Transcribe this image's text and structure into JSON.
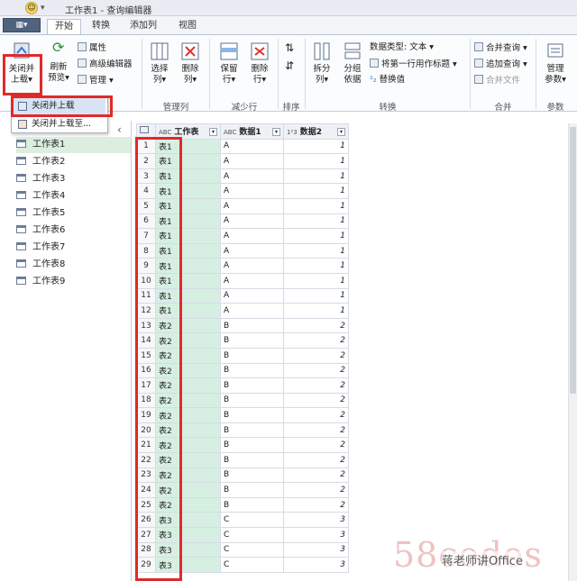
{
  "window": {
    "title": "工作表1 - 查询编辑器"
  },
  "tabs": {
    "file": "▦▾",
    "home": "开始",
    "transform": "转换",
    "add_column": "添加列",
    "view": "视图"
  },
  "ribbon": {
    "close_load": "关闭并\n上载",
    "close_load_line1": "关闭并",
    "close_load_line2": "上载",
    "refresh_line1": "刷新",
    "refresh_line2": "预览",
    "properties": "属性",
    "advanced_editor": "高级编辑器",
    "manage": "管理",
    "choose_cols_line1": "选择",
    "choose_cols_line2": "列",
    "remove_cols_line1": "删除",
    "remove_cols_line2": "列",
    "manage_cols_group": "管理列",
    "keep_rows_line1": "保留",
    "keep_rows_line2": "行",
    "remove_rows_line1": "删除",
    "remove_rows_line2": "行",
    "reduce_rows_group": "减少行",
    "sort_group": "排序",
    "split_line1": "拆分",
    "split_line2": "列",
    "group_line1": "分组",
    "group_line2": "依据",
    "data_type": "数据类型: 文本",
    "first_row_header": "将第一行用作标题",
    "replace_values": "替换值",
    "transform_group": "转换",
    "merge_queries": "合并查询",
    "append_queries": "追加查询",
    "combine_files": "合并文件",
    "combine_group": "合并",
    "manage_params_line1": "管理",
    "manage_params_line2": "参数",
    "params_group": "参数"
  },
  "dropdown": {
    "item1": "关闭并上载",
    "item2": "关闭并上载至..."
  },
  "queries": [
    "工作表1",
    "工作表2",
    "工作表3",
    "工作表4",
    "工作表5",
    "工作表6",
    "工作表7",
    "工作表8",
    "工作表9"
  ],
  "table": {
    "headers": [
      "",
      "ABC",
      "工作表",
      "ABC",
      "数据1",
      "123",
      "数据2"
    ],
    "col_src_icon": "ABC",
    "col_sheet": "工作表",
    "col_d1_icon": "ABC",
    "col_d1": "数据1",
    "col_d2_icon": "1²3",
    "col_d2": "数据2",
    "rows": [
      [
        "1",
        "表1",
        "A",
        "1"
      ],
      [
        "2",
        "表1",
        "A",
        "1"
      ],
      [
        "3",
        "表1",
        "A",
        "1"
      ],
      [
        "4",
        "表1",
        "A",
        "1"
      ],
      [
        "5",
        "表1",
        "A",
        "1"
      ],
      [
        "6",
        "表1",
        "A",
        "1"
      ],
      [
        "7",
        "表1",
        "A",
        "1"
      ],
      [
        "8",
        "表1",
        "A",
        "1"
      ],
      [
        "9",
        "表1",
        "A",
        "1"
      ],
      [
        "10",
        "表1",
        "A",
        "1"
      ],
      [
        "11",
        "表1",
        "A",
        "1"
      ],
      [
        "12",
        "表1",
        "A",
        "1"
      ],
      [
        "13",
        "表2",
        "B",
        "2"
      ],
      [
        "14",
        "表2",
        "B",
        "2"
      ],
      [
        "15",
        "表2",
        "B",
        "2"
      ],
      [
        "16",
        "表2",
        "B",
        "2"
      ],
      [
        "17",
        "表2",
        "B",
        "2"
      ],
      [
        "18",
        "表2",
        "B",
        "2"
      ],
      [
        "19",
        "表2",
        "B",
        "2"
      ],
      [
        "20",
        "表2",
        "B",
        "2"
      ],
      [
        "21",
        "表2",
        "B",
        "2"
      ],
      [
        "22",
        "表2",
        "B",
        "2"
      ],
      [
        "23",
        "表2",
        "B",
        "2"
      ],
      [
        "24",
        "表2",
        "B",
        "2"
      ],
      [
        "25",
        "表2",
        "B",
        "2"
      ],
      [
        "26",
        "表3",
        "C",
        "3"
      ],
      [
        "27",
        "表3",
        "C",
        "3"
      ],
      [
        "28",
        "表3",
        "C",
        "3"
      ],
      [
        "29",
        "表3",
        "C",
        "3"
      ]
    ]
  },
  "watermark": {
    "logo": "58codes",
    "text": "蒋老师讲Office"
  }
}
